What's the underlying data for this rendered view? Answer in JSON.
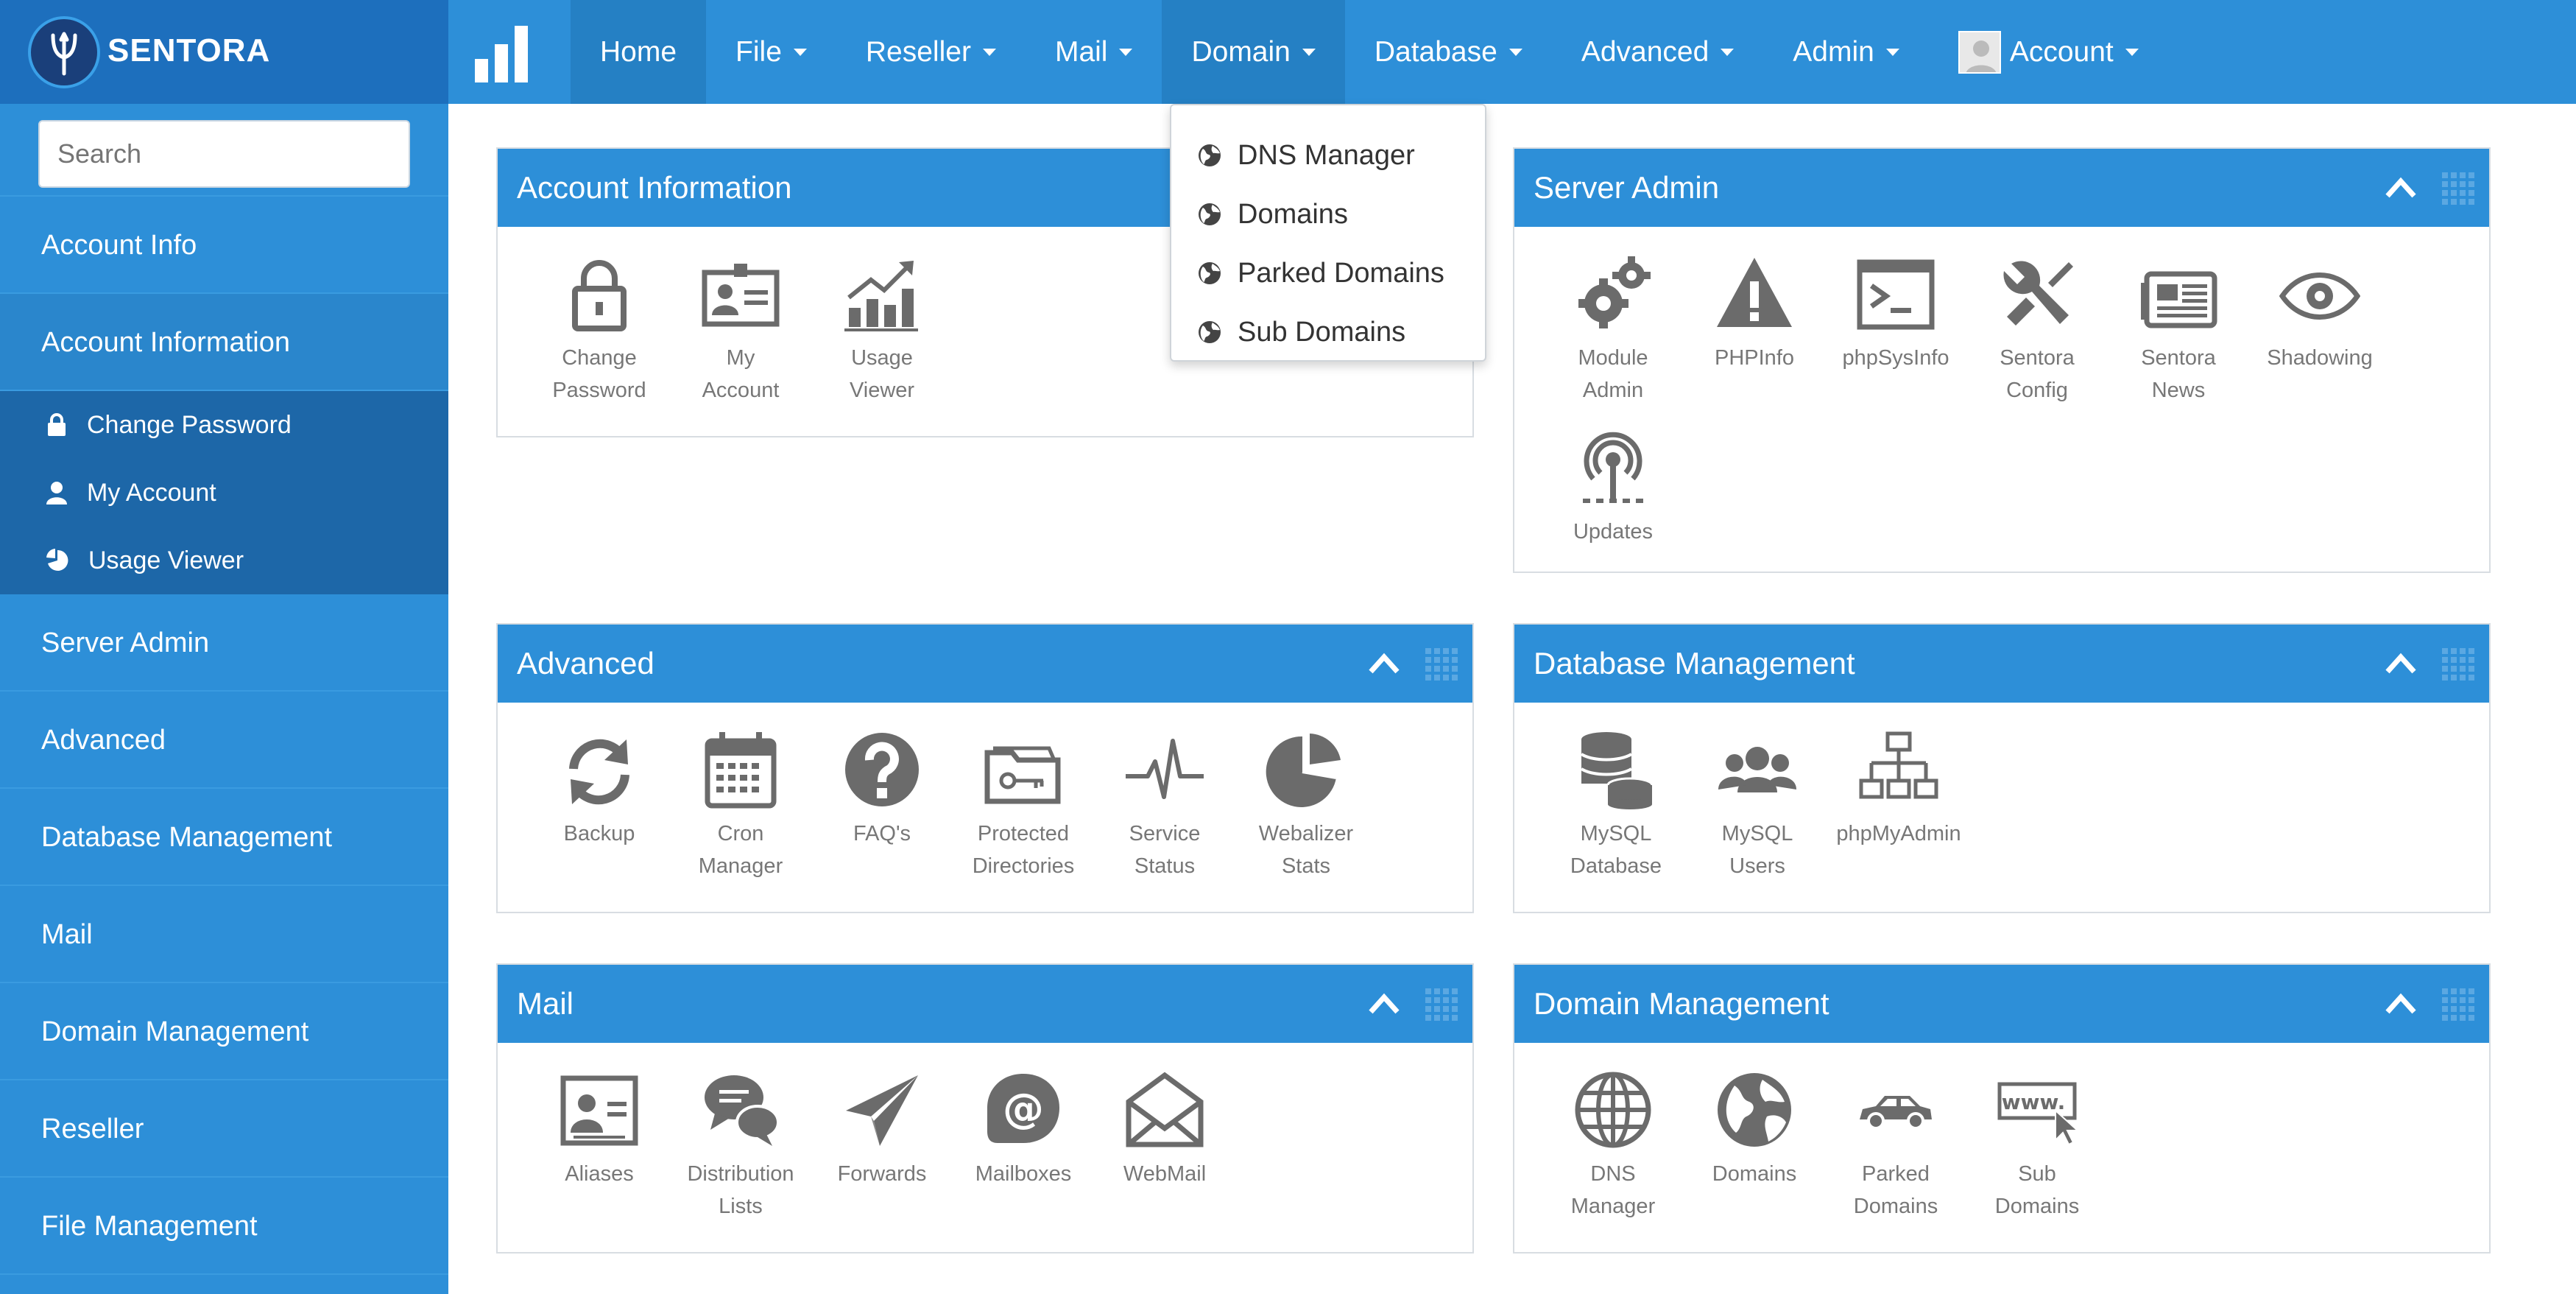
{
  "brand": {
    "name": "SENTORA"
  },
  "nav": {
    "items": [
      {
        "label": "Home"
      },
      {
        "label": "File"
      },
      {
        "label": "Reseller"
      },
      {
        "label": "Mail"
      },
      {
        "label": "Domain"
      },
      {
        "label": "Database"
      },
      {
        "label": "Advanced"
      },
      {
        "label": "Admin"
      },
      {
        "label": "Account"
      }
    ]
  },
  "domain_menu": {
    "items": [
      {
        "label": "DNS Manager"
      },
      {
        "label": "Domains"
      },
      {
        "label": "Parked Domains"
      },
      {
        "label": "Sub Domains"
      }
    ]
  },
  "sidebar": {
    "search_placeholder": "Search",
    "items": [
      {
        "label": "Account Info"
      },
      {
        "label": "Account Information"
      },
      {
        "label": "Server Admin"
      },
      {
        "label": "Advanced"
      },
      {
        "label": "Database Management"
      },
      {
        "label": "Mail"
      },
      {
        "label": "Domain Management"
      },
      {
        "label": "Reseller"
      },
      {
        "label": "File Management"
      }
    ],
    "sub_items": [
      {
        "label": "Change Password",
        "icon": "lock-icon"
      },
      {
        "label": "My Account",
        "icon": "user-icon"
      },
      {
        "label": "Usage Viewer",
        "icon": "pie-chart-icon"
      }
    ]
  },
  "panels": {
    "account": {
      "title": "Account Information",
      "icons": [
        "Change\nPassword",
        "My\nAccount",
        "Usage\nViewer"
      ]
    },
    "server": {
      "title": "Server Admin",
      "icons": [
        "Module\nAdmin",
        "PHPInfo",
        "phpSysInfo",
        "Sentora\nConfig",
        "Sentora\nNews",
        "Shadowing",
        "Updates"
      ]
    },
    "advanced": {
      "title": "Advanced",
      "icons": [
        "Backup",
        "Cron\nManager",
        "FAQ's",
        "Protected\nDirectories",
        "Service\nStatus",
        "Webalizer\nStats"
      ]
    },
    "database": {
      "title": "Database Management",
      "icons": [
        "MySQL\nDatabase",
        "MySQL\nUsers",
        "phpMyAdmin"
      ]
    },
    "mail": {
      "title": "Mail",
      "icons": [
        "Aliases",
        "Distribution\nLists",
        "Forwards",
        "Mailboxes",
        "WebMail"
      ]
    },
    "domain": {
      "title": "Domain Management",
      "icons": [
        "DNS\nManager",
        "Domains",
        "Parked\nDomains",
        "Sub\nDomains"
      ]
    }
  },
  "colors": {
    "accent": "#2d8fd8",
    "sidebar_sub": "#1d67a8",
    "icon": "#6b6b6b"
  }
}
